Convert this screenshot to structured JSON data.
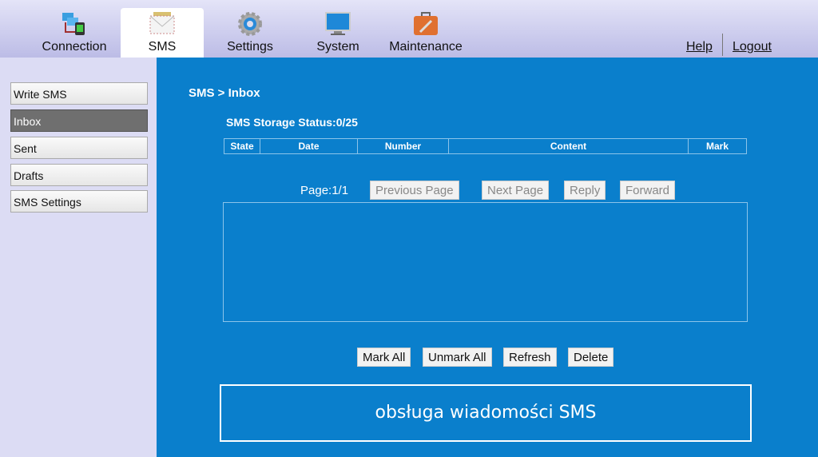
{
  "nav": {
    "tabs": [
      {
        "label": "Connection",
        "icon": "connection-icon"
      },
      {
        "label": "SMS",
        "icon": "envelope-icon",
        "active": true
      },
      {
        "label": "Settings",
        "icon": "gear-icon"
      },
      {
        "label": "System",
        "icon": "monitor-icon"
      },
      {
        "label": "Maintenance",
        "icon": "toolbox-icon"
      }
    ],
    "help": "Help",
    "logout": "Logout"
  },
  "sidebar": {
    "items": [
      {
        "label": "Write SMS"
      },
      {
        "label": "Inbox",
        "active": true
      },
      {
        "label": "Sent"
      },
      {
        "label": "Drafts"
      },
      {
        "label": "SMS Settings"
      }
    ]
  },
  "main": {
    "breadcrumb": "SMS > Inbox",
    "storage": "SMS Storage Status:0/25",
    "columns": [
      "State",
      "Date",
      "Number",
      "Content",
      "Mark"
    ],
    "page": "Page:1/1",
    "prev": "Previous Page",
    "next": "Next Page",
    "reply": "Reply",
    "forward": "Forward",
    "mark_all": "Mark All",
    "unmark_all": "Unmark All",
    "refresh": "Refresh",
    "delete": "Delete",
    "footer": "obsługa wiadomości SMS"
  },
  "colors": {
    "background": "#0a7fcc",
    "sidebar": "#dcdcf4",
    "active_item": "#6f6f6f"
  }
}
